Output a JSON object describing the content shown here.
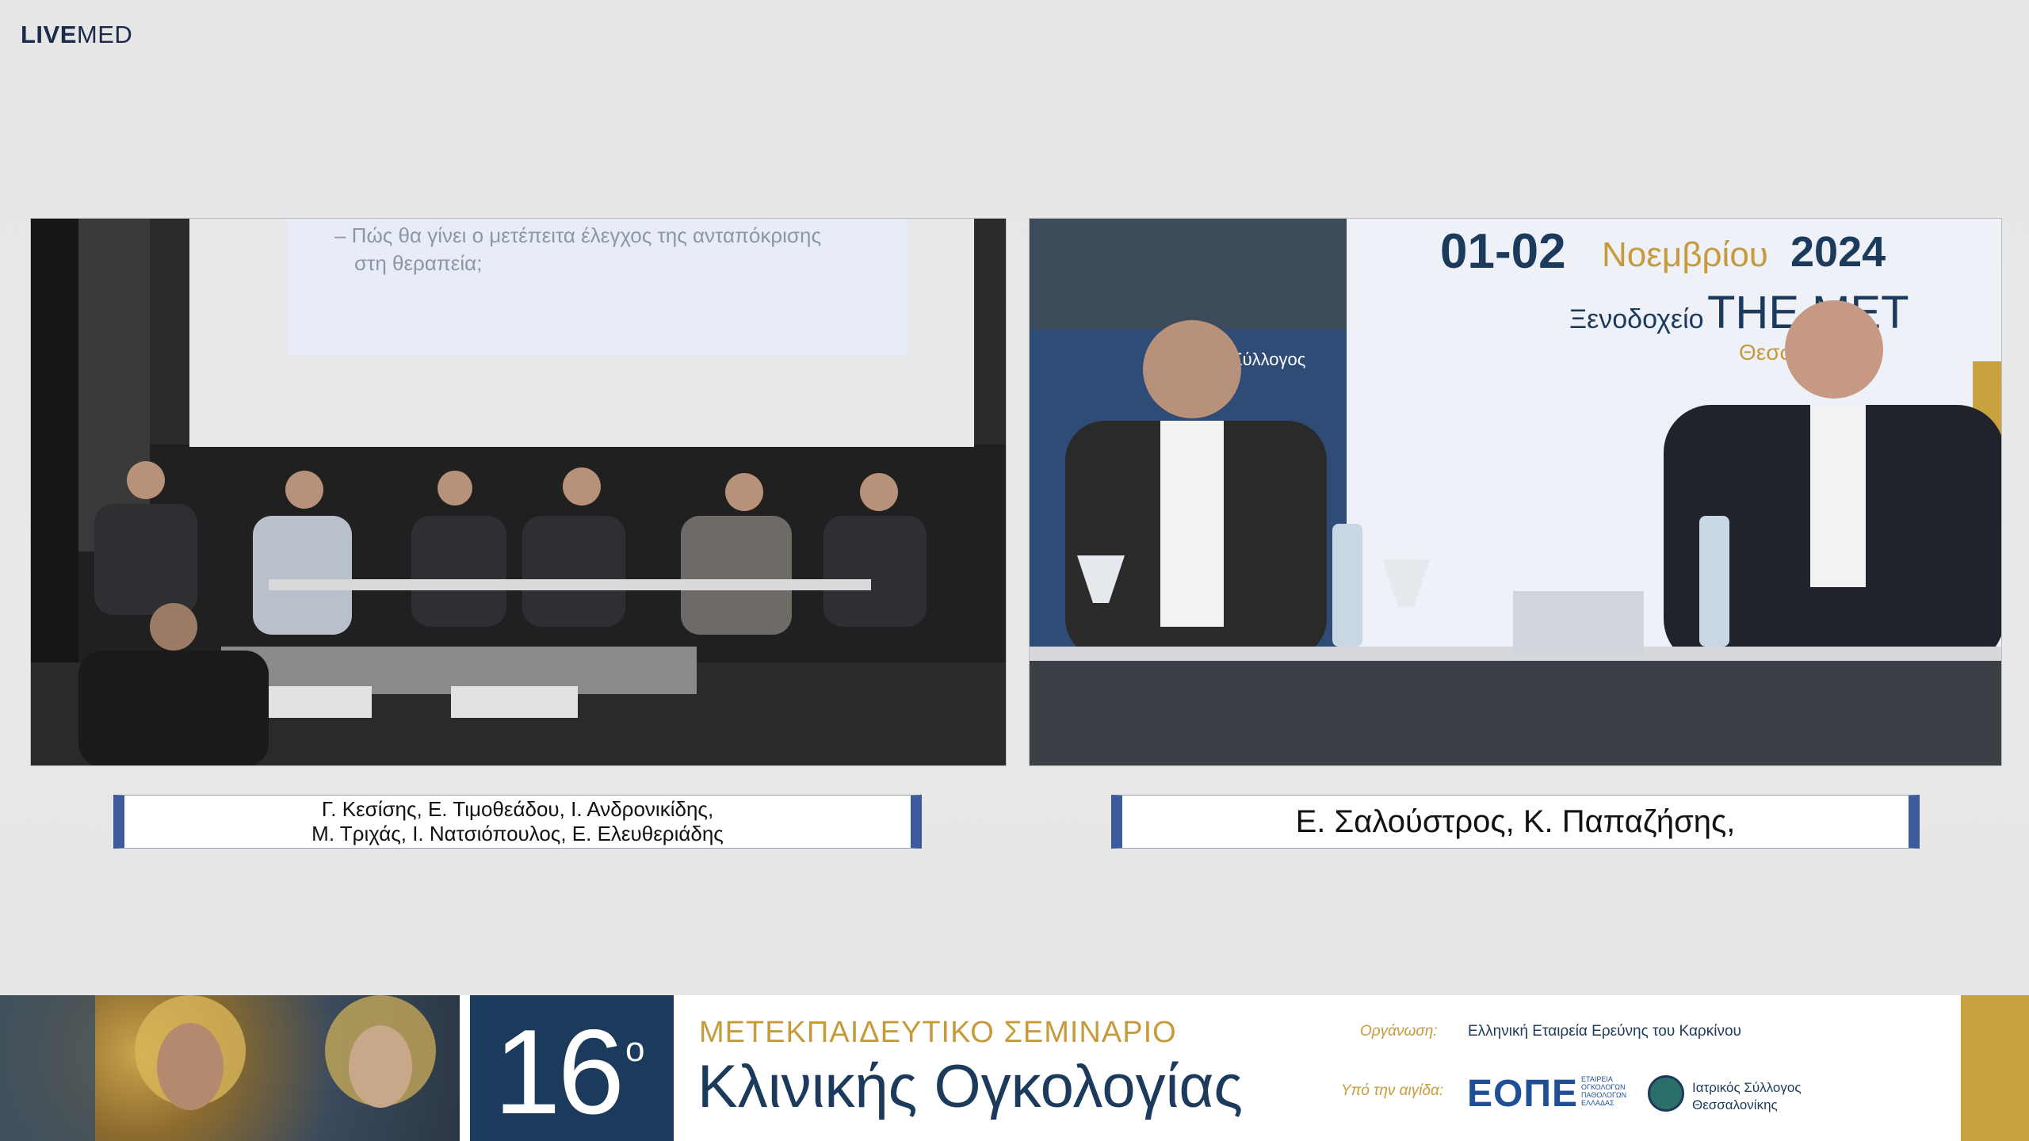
{
  "logo": {
    "bold": "LIVE",
    "light": "MED"
  },
  "left_video": {
    "slide_line1": "– Πώς θα γίνει ο μετέπειτα έλεγχος της ανταπόκρισης",
    "slide_line2": "στη θεραπεία;"
  },
  "right_video": {
    "backdrop_date": "01-02",
    "backdrop_month": "Νοεμβρίου",
    "backdrop_year": "2024",
    "backdrop_venue_prefix": "Ξενοδοχείο",
    "backdrop_venue": "THE MET",
    "backdrop_city": "Θεσσ",
    "backdrop_society": "Σύλλογος"
  },
  "captions": {
    "left_line1": "Γ. Κεσίσης, Ε. Τιμοθεάδου, Ι. Ανδρονικίδης,",
    "left_line2": "Μ. Τριχάς, Ι. Νατσιόπουλος, Ε. Ελευθεριάδης",
    "right": "Ε. Σαλούστρος, Κ. Παπαζήσης,"
  },
  "banner": {
    "number": "16",
    "ordinal": "ο",
    "title_top": "ΜΕΤΕΚΠΑΙΔΕΥΤΙΚΟ ΣΕΜΙΝΑΡΙΟ",
    "title_main": "Κλινικής Ογκολογίας",
    "org_label": "Οργάνωση:",
    "org_text": "Ελληνική Εταιρεία Ερεύνης του Καρκίνου",
    "aegis_label": "Υπό την αιγίδα:",
    "eope": "ΕΟΠΕ",
    "eope_sub1": "ΕΤΑΙΡΕΙΑ",
    "eope_sub2": "ΟΓΚΟΛΟΓΩΝ",
    "eope_sub3": "ΠΑΘΟΛΟΓΩΝ",
    "eope_sub4": "ΕΛΛΑΔΑΣ",
    "med_line1": "Ιατρικός Σύλλογος",
    "med_line2": "Θεσσαλονίκης"
  },
  "colors": {
    "navy": "#1b3a5c",
    "gold": "#c79b3b",
    "caption_border": "#3c5a9c"
  }
}
